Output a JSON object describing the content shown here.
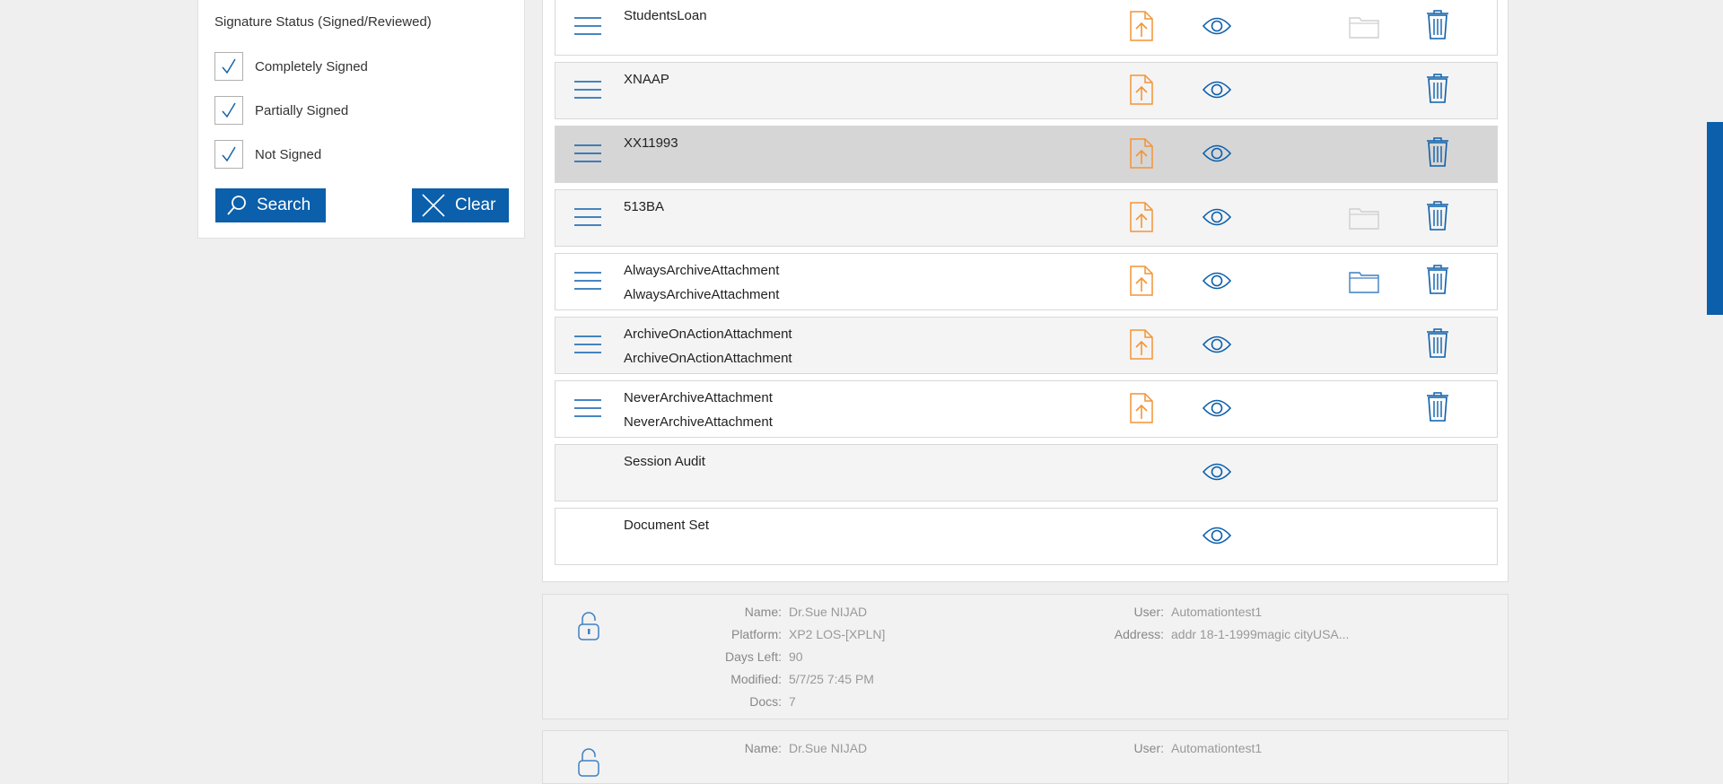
{
  "filter": {
    "title": "Signature Status (Signed/Reviewed)",
    "checkboxes": [
      {
        "label": "Completely Signed",
        "checked": true
      },
      {
        "label": "Partially Signed",
        "checked": true
      },
      {
        "label": "Not Signed",
        "checked": true
      }
    ],
    "search_label": "Search",
    "clear_label": "Clear"
  },
  "documents": [
    {
      "name": "StudentsLoan",
      "sub": "",
      "has_menu": true,
      "has_upload": true,
      "folder": "faded",
      "has_trash": true
    },
    {
      "name": "XNAAP",
      "sub": "",
      "has_menu": true,
      "has_upload": true,
      "folder": "none",
      "has_trash": true
    },
    {
      "name": "XX11993",
      "sub": "",
      "has_menu": true,
      "has_upload": true,
      "folder": "none",
      "has_trash": true,
      "selected": true
    },
    {
      "name": "513BA",
      "sub": "",
      "has_menu": true,
      "has_upload": true,
      "folder": "faded",
      "has_trash": true
    },
    {
      "name": "AlwaysArchiveAttachment",
      "sub": "AlwaysArchiveAttachment",
      "has_menu": true,
      "has_upload": true,
      "folder": "active",
      "has_trash": true
    },
    {
      "name": "ArchiveOnActionAttachment",
      "sub": "ArchiveOnActionAttachment",
      "has_menu": true,
      "has_upload": true,
      "folder": "none",
      "has_trash": true
    },
    {
      "name": "NeverArchiveAttachment",
      "sub": "NeverArchiveAttachment",
      "has_menu": true,
      "has_upload": true,
      "folder": "none",
      "has_trash": true
    },
    {
      "name": "Session Audit",
      "sub": "",
      "has_menu": false,
      "has_upload": false,
      "folder": "none",
      "has_trash": false
    },
    {
      "name": "Document Set",
      "sub": "",
      "has_menu": false,
      "has_upload": false,
      "folder": "none",
      "has_trash": false
    }
  ],
  "packages": [
    {
      "name_label": "Name:",
      "name": "Dr.Sue NIJAD",
      "platform_label": "Platform:",
      "platform": "XP2 LOS-[XPLN]",
      "days_left_label": "Days Left:",
      "days_left": "90",
      "modified_label": "Modified:",
      "modified": "5/7/25 7:45 PM",
      "docs_label": "Docs:",
      "docs": "7",
      "user_label": "User:",
      "user": "Automationtest1",
      "address_label": "Address:",
      "address": "addr 18-1-1999magic cityUSA..."
    },
    {
      "name_label": "Name:",
      "name": "Dr.Sue NIJAD",
      "user_label": "User:",
      "user": "Automationtest1"
    }
  ],
  "colors": {
    "primary": "#0b5fab",
    "upload": "#f39436",
    "folder_active": "#3d7fc1",
    "folder_faded": "#cfcfcf"
  },
  "icons": {
    "menu": "hamburger-icon",
    "upload": "file-upload-icon",
    "view": "eye-icon",
    "folder": "folder-icon",
    "trash": "trash-icon",
    "lock": "lock-icon",
    "search": "search-icon",
    "clear": "close-icon",
    "check": "check-icon"
  }
}
